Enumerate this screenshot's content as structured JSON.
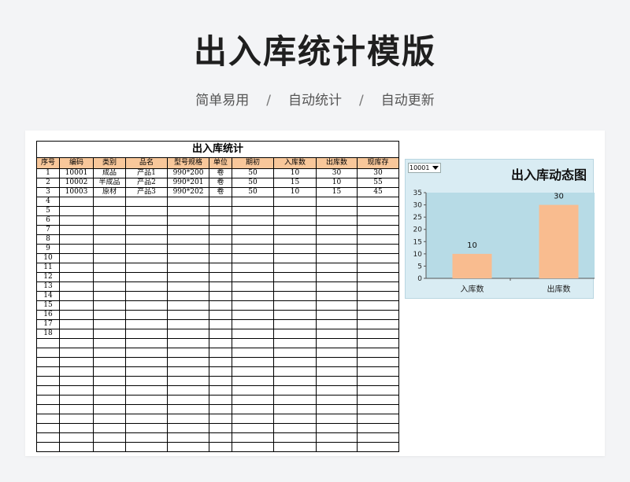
{
  "page": {
    "title": "出入库统计模版",
    "subtitle": [
      "简单易用",
      "自动统计",
      "自动更新"
    ],
    "separator": "/"
  },
  "table": {
    "title": "出入库统计",
    "columns": [
      "序号",
      "编码",
      "类别",
      "品名",
      "型号规格",
      "单位",
      "期初",
      "入库数",
      "出库数",
      "现库存"
    ],
    "rows": [
      [
        "1",
        "10001",
        "成品",
        "产品1",
        "990*200",
        "卷",
        "50",
        "10",
        "30",
        "30"
      ],
      [
        "2",
        "10002",
        "半成品",
        "产品2",
        "990*201",
        "卷",
        "50",
        "15",
        "10",
        "55"
      ],
      [
        "3",
        "10003",
        "原材",
        "产品3",
        "990*202",
        "卷",
        "50",
        "10",
        "15",
        "45"
      ],
      [
        "4",
        "",
        "",
        "",
        "",
        "",
        "",
        "",
        "",
        ""
      ],
      [
        "5",
        "",
        "",
        "",
        "",
        "",
        "",
        "",
        "",
        ""
      ],
      [
        "6",
        "",
        "",
        "",
        "",
        "",
        "",
        "",
        "",
        ""
      ],
      [
        "7",
        "",
        "",
        "",
        "",
        "",
        "",
        "",
        "",
        ""
      ],
      [
        "8",
        "",
        "",
        "",
        "",
        "",
        "",
        "",
        "",
        ""
      ],
      [
        "9",
        "",
        "",
        "",
        "",
        "",
        "",
        "",
        "",
        ""
      ],
      [
        "10",
        "",
        "",
        "",
        "",
        "",
        "",
        "",
        "",
        ""
      ],
      [
        "11",
        "",
        "",
        "",
        "",
        "",
        "",
        "",
        "",
        ""
      ],
      [
        "12",
        "",
        "",
        "",
        "",
        "",
        "",
        "",
        "",
        ""
      ],
      [
        "13",
        "",
        "",
        "",
        "",
        "",
        "",
        "",
        "",
        ""
      ],
      [
        "14",
        "",
        "",
        "",
        "",
        "",
        "",
        "",
        "",
        ""
      ],
      [
        "15",
        "",
        "",
        "",
        "",
        "",
        "",
        "",
        "",
        ""
      ],
      [
        "16",
        "",
        "",
        "",
        "",
        "",
        "",
        "",
        "",
        ""
      ],
      [
        "17",
        "",
        "",
        "",
        "",
        "",
        "",
        "",
        "",
        ""
      ],
      [
        "18",
        "",
        "",
        "",
        "",
        "",
        "",
        "",
        "",
        ""
      ],
      [
        "",
        "",
        "",
        "",
        "",
        "",
        "",
        "",
        "",
        ""
      ],
      [
        "",
        "",
        "",
        "",
        "",
        "",
        "",
        "",
        "",
        ""
      ],
      [
        "",
        "",
        "",
        "",
        "",
        "",
        "",
        "",
        "",
        ""
      ],
      [
        "",
        "",
        "",
        "",
        "",
        "",
        "",
        "",
        "",
        ""
      ],
      [
        "",
        "",
        "",
        "",
        "",
        "",
        "",
        "",
        "",
        ""
      ],
      [
        "",
        "",
        "",
        "",
        "",
        "",
        "",
        "",
        "",
        ""
      ],
      [
        "",
        "",
        "",
        "",
        "",
        "",
        "",
        "",
        "",
        ""
      ],
      [
        "",
        "",
        "",
        "",
        "",
        "",
        "",
        "",
        "",
        ""
      ],
      [
        "",
        "",
        "",
        "",
        "",
        "",
        "",
        "",
        "",
        ""
      ],
      [
        "",
        "",
        "",
        "",
        "",
        "",
        "",
        "",
        "",
        ""
      ],
      [
        "",
        "",
        "",
        "",
        "",
        "",
        "",
        "",
        "",
        ""
      ],
      [
        "",
        "",
        "",
        "",
        "",
        "",
        "",
        "",
        "",
        ""
      ]
    ]
  },
  "chart_data": {
    "type": "bar",
    "title": "出入库动态图",
    "selector_value": "10001",
    "categories": [
      "入库数",
      "出库数"
    ],
    "values": [
      10,
      30
    ],
    "data_labels": [
      "10",
      "30"
    ],
    "ylim": [
      0,
      35
    ],
    "yticks": [
      "0",
      "5",
      "10",
      "15",
      "20",
      "25",
      "30",
      "35"
    ],
    "bar_color": "#f9bc8f",
    "plot_bg": "#b7dbe6",
    "chart_bg": "#d9ecf3",
    "grid": false,
    "legend": "none"
  },
  "colors": {
    "header_fill": "#f8c79a",
    "page_bg": "#f3f4f6"
  }
}
